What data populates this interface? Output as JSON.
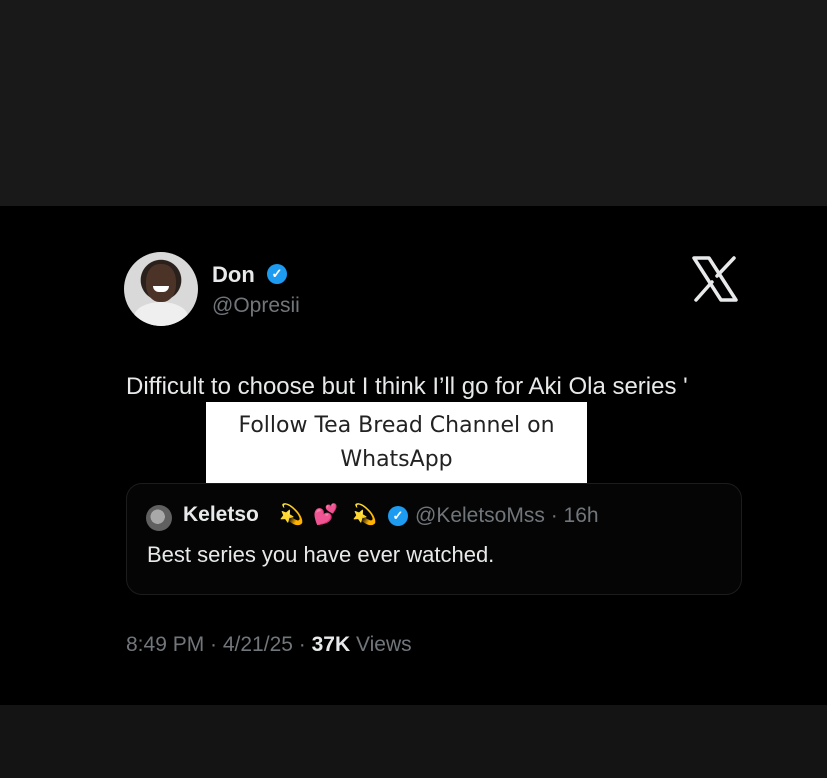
{
  "tweet": {
    "author_name": "Don",
    "author_handle": "@Opresii",
    "verified_mark": "✓",
    "text": "Difficult to choose but I think I’ll go for Aki Ola series",
    "obscured_fragment": "'",
    "logo": "x-logo"
  },
  "overlay": {
    "text": "Follow Tea Bread Channel on WhatsApp"
  },
  "quote": {
    "author_name": "Keletso",
    "emoji_1": "💫",
    "emoji_2": "💕",
    "emoji_3": "💫",
    "handle_time": "@KeletsoMss · 16h",
    "text": "Best series you have ever watched."
  },
  "meta": {
    "time_date": "8:49 PM · 4/21/25 ·",
    "views_count": "37K",
    "views_label": "Views"
  },
  "colors": {
    "background": "#000000",
    "text_primary": "#e7e9ea",
    "text_secondary": "#71767b",
    "verified": "#1d9bf0"
  }
}
